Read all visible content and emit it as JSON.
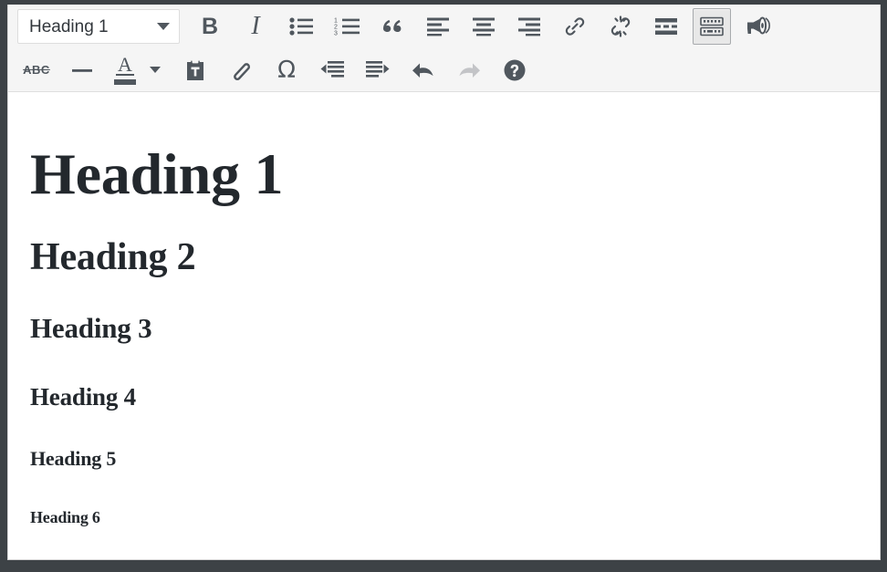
{
  "window": {
    "frame_color": "#3d4246",
    "toolbar_bg": "#f5f5f5",
    "content_bg": "#ffffff",
    "icon_color": "#50575e",
    "heading_color": "#23282d"
  },
  "toolbar": {
    "format_select": {
      "value": "Heading 1",
      "caret_icon": "chevron-down-icon"
    },
    "row1": [
      {
        "name": "bold-button",
        "label": "B",
        "icon": "bold-icon",
        "state": "normal"
      },
      {
        "name": "italic-button",
        "label": "I",
        "icon": "italic-icon",
        "state": "normal"
      },
      {
        "name": "bulleted-list-button",
        "label": "",
        "icon": "bulleted-list-icon",
        "state": "normal"
      },
      {
        "name": "numbered-list-button",
        "label": "",
        "icon": "numbered-list-icon",
        "state": "normal"
      },
      {
        "name": "blockquote-button",
        "label": "",
        "icon": "blockquote-icon",
        "state": "normal"
      },
      {
        "name": "align-left-button",
        "label": "",
        "icon": "align-left-icon",
        "state": "normal"
      },
      {
        "name": "align-center-button",
        "label": "",
        "icon": "align-center-icon",
        "state": "normal"
      },
      {
        "name": "align-right-button",
        "label": "",
        "icon": "align-right-icon",
        "state": "normal"
      },
      {
        "name": "insert-link-button",
        "label": "",
        "icon": "link-icon",
        "state": "normal"
      },
      {
        "name": "remove-link-button",
        "label": "",
        "icon": "unlink-icon",
        "state": "normal"
      },
      {
        "name": "insert-read-more-button",
        "label": "",
        "icon": "read-more-icon",
        "state": "normal"
      },
      {
        "name": "toolbar-toggle-button",
        "label": "",
        "icon": "keyboard-icon",
        "state": "active"
      },
      {
        "name": "distraction-free-button",
        "label": "",
        "icon": "megaphone-icon",
        "state": "normal"
      }
    ],
    "row2": [
      {
        "name": "strikethrough-button",
        "label": "ABC",
        "icon": "strikethrough-icon",
        "state": "normal"
      },
      {
        "name": "horizontal-rule-button",
        "label": "",
        "icon": "horizontal-rule-icon",
        "state": "normal"
      },
      {
        "name": "text-color-button",
        "label": "A",
        "icon": "text-color-icon",
        "state": "normal"
      },
      {
        "name": "text-color-caret",
        "label": "",
        "icon": "chevron-down-icon",
        "state": "normal"
      },
      {
        "name": "paste-as-text-button",
        "label": "",
        "icon": "clipboard-icon",
        "state": "normal"
      },
      {
        "name": "clear-formatting-button",
        "label": "",
        "icon": "eraser-icon",
        "state": "normal"
      },
      {
        "name": "special-character-button",
        "label": "Ω",
        "icon": "omega-icon",
        "state": "normal"
      },
      {
        "name": "decrease-indent-button",
        "label": "",
        "icon": "outdent-icon",
        "state": "normal"
      },
      {
        "name": "increase-indent-button",
        "label": "",
        "icon": "indent-icon",
        "state": "normal"
      },
      {
        "name": "undo-button",
        "label": "",
        "icon": "undo-icon",
        "state": "normal"
      },
      {
        "name": "redo-button",
        "label": "",
        "icon": "redo-icon",
        "state": "disabled"
      },
      {
        "name": "keyboard-shortcuts-button",
        "label": "",
        "icon": "help-icon",
        "state": "normal"
      }
    ]
  },
  "content": {
    "headings": [
      {
        "level": 1,
        "text": "Heading  1"
      },
      {
        "level": 2,
        "text": "Heading 2"
      },
      {
        "level": 3,
        "text": "Heading 3"
      },
      {
        "level": 4,
        "text": "Heading 4"
      },
      {
        "level": 5,
        "text": "Heading 5"
      },
      {
        "level": 6,
        "text": "Heading 6"
      }
    ]
  }
}
